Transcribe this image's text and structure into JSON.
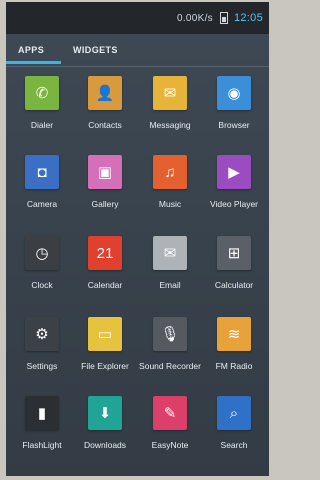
{
  "status_bar": {
    "speed": "0.00K/s",
    "time": "12:05"
  },
  "tabs": [
    {
      "label": "APPS"
    },
    {
      "label": "WIDGETS"
    }
  ],
  "colors": {
    "accent": "#33b5e5"
  },
  "apps": [
    {
      "label": "Dialer",
      "icon": "phone-icon",
      "glyph": "✆",
      "color": "#7ab540"
    },
    {
      "label": "Contacts",
      "icon": "contacts-icon",
      "glyph": "👤",
      "color": "#d89a3c"
    },
    {
      "label": "Messaging",
      "icon": "messaging-icon",
      "glyph": "✉",
      "color": "#e7b43a"
    },
    {
      "label": "Browser",
      "icon": "browser-icon",
      "glyph": "◉",
      "color": "#3a8fd8"
    },
    {
      "label": "Camera",
      "icon": "camera-icon",
      "glyph": "◘",
      "color": "#3b6fc4"
    },
    {
      "label": "Gallery",
      "icon": "gallery-icon",
      "glyph": "▣",
      "color": "#d46fb8"
    },
    {
      "label": "Music",
      "icon": "music-icon",
      "glyph": "♫",
      "color": "#e5602f"
    },
    {
      "label": "Video Player",
      "icon": "video-icon",
      "glyph": "▶",
      "color": "#9a4cc0"
    },
    {
      "label": "Clock",
      "icon": "clock-icon",
      "glyph": "◷",
      "color": "#3b3f44"
    },
    {
      "label": "Calendar",
      "icon": "calendar-icon",
      "glyph": "21",
      "color": "#e0402e"
    },
    {
      "label": "Email",
      "icon": "email-icon",
      "glyph": "✉",
      "color": "#aeb3b8"
    },
    {
      "label": "Calculator",
      "icon": "calculator-icon",
      "glyph": "⊞",
      "color": "#5b6068"
    },
    {
      "label": "Settings",
      "icon": "settings-icon",
      "glyph": "⚙",
      "color": "#3c4148"
    },
    {
      "label": "File Explorer",
      "icon": "folder-icon",
      "glyph": "▭",
      "color": "#e6c23d"
    },
    {
      "label": "Sound Recorder",
      "icon": "microphone-icon",
      "glyph": "🎙",
      "color": "#555a61"
    },
    {
      "label": "FM Radio",
      "icon": "radio-icon",
      "glyph": "≋",
      "color": "#e8a23a"
    },
    {
      "label": "FlashLight",
      "icon": "flashlight-icon",
      "glyph": "▮",
      "color": "#2b2e33"
    },
    {
      "label": "Downloads",
      "icon": "download-icon",
      "glyph": "⬇",
      "color": "#1fa495"
    },
    {
      "label": "EasyNote",
      "icon": "note-icon",
      "glyph": "✎",
      "color": "#dc3f6a"
    },
    {
      "label": "Search",
      "icon": "search-icon",
      "glyph": "⌕",
      "color": "#2f71c6"
    }
  ]
}
